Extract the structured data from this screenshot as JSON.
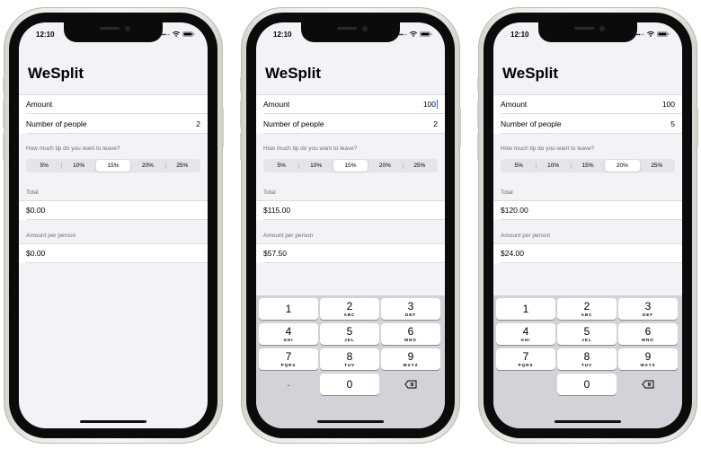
{
  "status_bar": {
    "time": "12:10"
  },
  "keypad_keys": [
    {
      "digit": "1",
      "letters": ""
    },
    {
      "digit": "2",
      "letters": "ABC"
    },
    {
      "digit": "3",
      "letters": "DEF"
    },
    {
      "digit": "4",
      "letters": "GHI"
    },
    {
      "digit": "5",
      "letters": "JKL"
    },
    {
      "digit": "6",
      "letters": "MNO"
    },
    {
      "digit": "7",
      "letters": "PQRS"
    },
    {
      "digit": "8",
      "letters": "TUV"
    },
    {
      "digit": "9",
      "letters": "WXYZ"
    }
  ],
  "phones": [
    {
      "app_title": "WeSplit",
      "amount_label": "Amount",
      "amount_value": "",
      "people_label": "Number of people",
      "people_value": "2",
      "tip_header": "How much tip do you want to leave?",
      "tip_options": [
        "5%",
        "10%",
        "15%",
        "20%",
        "25%"
      ],
      "tip_selected": "15%",
      "total_header": "Total",
      "total_value": "$0.00",
      "per_person_header": "Amount per person",
      "per_person_value": "$0.00",
      "keyboard_visible": false
    },
    {
      "app_title": "WeSplit",
      "amount_label": "Amount",
      "amount_value": "100",
      "people_label": "Number of people",
      "people_value": "2",
      "tip_header": "How much tip do you want to leave?",
      "tip_options": [
        "5%",
        "10%",
        "15%",
        "20%",
        "25%"
      ],
      "tip_selected": "15%",
      "total_header": "Total",
      "total_value": "$115.00",
      "per_person_header": "Amount per person",
      "per_person_value": "$57.50",
      "keyboard_visible": true,
      "keypad_decimal": ".",
      "keypad_zero": "0"
    },
    {
      "app_title": "WeSplit",
      "amount_label": "Amount",
      "amount_value": "100",
      "people_label": "Number of people",
      "people_value": "5",
      "tip_header": "How much tip do you want to leave?",
      "tip_options": [
        "5%",
        "10%",
        "15%",
        "20%",
        "25%"
      ],
      "tip_selected": "20%",
      "total_header": "Total",
      "total_value": "$120.00",
      "per_person_header": "Amount per person",
      "per_person_value": "$24.00",
      "keyboard_visible": true,
      "keypad_decimal": "",
      "keypad_zero": "0"
    }
  ]
}
